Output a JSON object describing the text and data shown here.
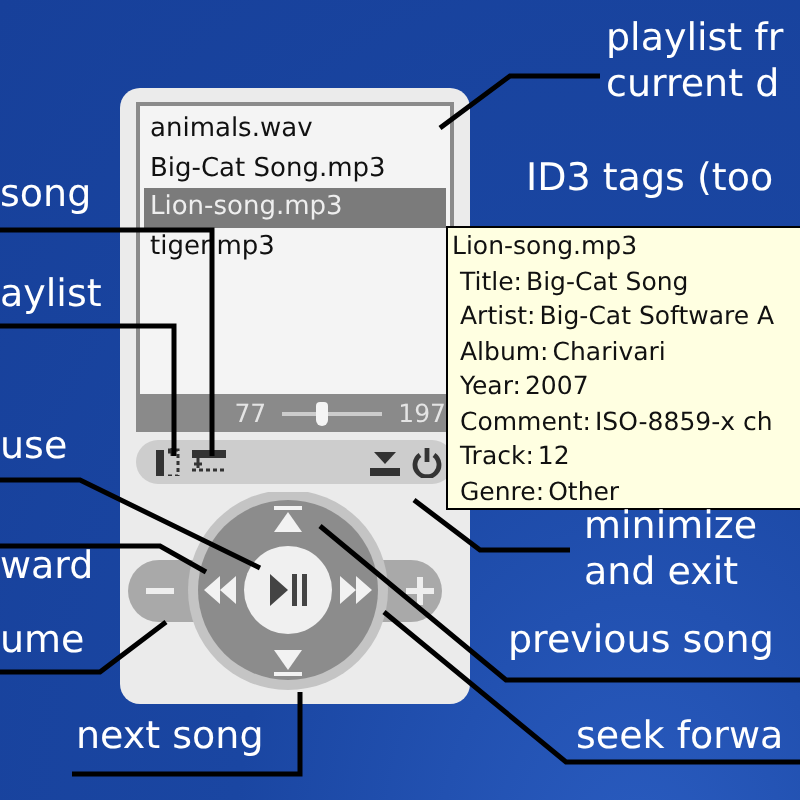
{
  "callouts": [
    {
      "lines": [
        "playlist fr",
        "current d"
      ]
    },
    {
      "lines": [
        "ID3 tags (too"
      ]
    },
    {
      "lines": [
        "song"
      ]
    },
    {
      "lines": [
        "aylist"
      ]
    },
    {
      "lines": [
        "use"
      ]
    },
    {
      "lines": [
        "ward"
      ]
    },
    {
      "lines": [
        "minimize",
        "and exit"
      ]
    },
    {
      "lines": [
        "ume"
      ]
    },
    {
      "lines": [
        "previous song"
      ]
    },
    {
      "lines": [
        "next song"
      ]
    },
    {
      "lines": [
        "seek forwa"
      ]
    }
  ],
  "playlist": {
    "items": [
      {
        "name": "animals.wav",
        "selected": false
      },
      {
        "name": "Big-Cat Song.mp3",
        "selected": false
      },
      {
        "name": "Lion-song.mp3",
        "selected": true
      },
      {
        "name": "tiger.mp3",
        "selected": false
      }
    ]
  },
  "position": {
    "start": "77",
    "end": "197",
    "level": 0.4
  },
  "tooltip": {
    "title": "Lion-song.mp3",
    "fields": [
      {
        "label": "Title:",
        "value": "Big-Cat Song"
      },
      {
        "label": "Artist:",
        "value": "Big-Cat Software A"
      },
      {
        "label": "Album:",
        "value": "Charivari"
      },
      {
        "label": "Year:",
        "value": "2007"
      },
      {
        "label": "Comment:",
        "value": "ISO-8859-x ch"
      },
      {
        "label": "Track:",
        "value": "12"
      },
      {
        "label": "Genre:",
        "value": "Other"
      }
    ]
  }
}
